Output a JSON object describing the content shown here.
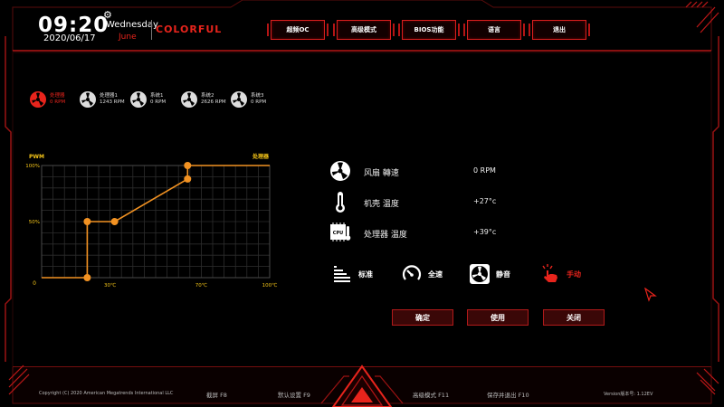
{
  "header": {
    "time": "09:20",
    "date": "2020/06/17",
    "weekday": "Wednesday",
    "month": "June",
    "brand": "COLORFUL"
  },
  "nav": [
    {
      "label": "超频OC"
    },
    {
      "label": "高级模式"
    },
    {
      "label": "BIOS功能"
    },
    {
      "label": "语言"
    },
    {
      "label": "退出"
    }
  ],
  "fans": [
    {
      "name": "处理器",
      "rpm": "0 RPM",
      "active": true
    },
    {
      "name": "处理器1",
      "rpm": "1243 RPM",
      "active": false
    },
    {
      "name": "系统1",
      "rpm": "0 RPM",
      "active": false
    },
    {
      "name": "系统2",
      "rpm": "2626 RPM",
      "active": false
    },
    {
      "name": "系统3",
      "rpm": "0 RPM",
      "active": false
    }
  ],
  "chart_data": {
    "type": "line",
    "ylabel": "PWM",
    "series_label": "处理器",
    "y_ticks": [
      "100%",
      "50%",
      "0"
    ],
    "x_ticks": [
      {
        "value": 30,
        "label": "30℃"
      },
      {
        "value": 70,
        "label": "70℃"
      },
      {
        "value": 100,
        "label": "100℃"
      }
    ],
    "xlim": [
      0,
      100
    ],
    "ylim": [
      0,
      100
    ],
    "grid": true,
    "line_color": "#f29222",
    "points": [
      {
        "x": 0,
        "y": 0
      },
      {
        "x": 20,
        "y": 0
      },
      {
        "x": 20,
        "y": 50
      },
      {
        "x": 32,
        "y": 50
      },
      {
        "x": 64,
        "y": 88
      },
      {
        "x": 64,
        "y": 100
      },
      {
        "x": 100,
        "y": 100
      }
    ],
    "handles": [
      {
        "x": 20,
        "y": 0
      },
      {
        "x": 20,
        "y": 50
      },
      {
        "x": 32,
        "y": 50
      },
      {
        "x": 64,
        "y": 88
      },
      {
        "x": 64,
        "y": 100
      }
    ]
  },
  "readouts": [
    {
      "label": "风扇 轉速",
      "value": "0 RPM",
      "icon": "fan-icon"
    },
    {
      "label": "机壳 温度",
      "value": "+27°c",
      "icon": "thermometer-icon"
    },
    {
      "label": "处理器 温度",
      "value": "+39°c",
      "icon": "cpu-temp-icon",
      "icon_text": "CPU"
    }
  ],
  "modes": [
    {
      "label": "标准",
      "icon": "bars-icon",
      "active": false
    },
    {
      "label": "全速",
      "icon": "gauge-icon",
      "active": false
    },
    {
      "label": "静音",
      "icon": "silent-fan-icon",
      "active": false
    },
    {
      "label": "手动",
      "icon": "hand-pointer-icon",
      "active": true
    }
  ],
  "actions": [
    {
      "label": "确定"
    },
    {
      "label": "使用"
    },
    {
      "label": "关闭"
    }
  ],
  "footer": {
    "copyright": "Copyright (C) 2020 American Megatrends International LLC",
    "screenshot": "截屏 F8",
    "defaults": "默认设置 F9",
    "advanced": "高级模式 F11",
    "save_exit": "保存并退出 F10",
    "version": "Version版本号: 1.12EV"
  },
  "colors": {
    "accent": "#e8241c",
    "curve": "#f29222",
    "frame": "#d81e1e"
  }
}
